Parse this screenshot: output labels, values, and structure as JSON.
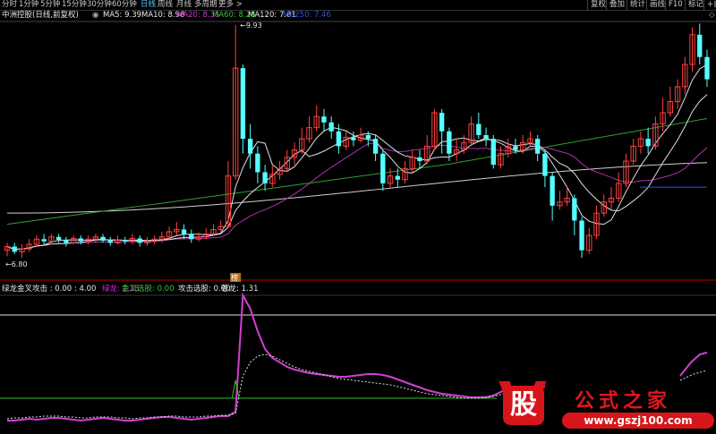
{
  "toolbar": {
    "tabs": [
      "分时",
      "1分钟",
      "5分钟",
      "15分钟",
      "30分钟",
      "60分钟",
      "日线",
      "周线",
      "月线",
      "多周期",
      "更多 >"
    ],
    "active_tab": "日线",
    "right_buttons": [
      "复权",
      "叠加",
      "统计",
      "画线",
      "F10",
      "标记",
      "+自"
    ]
  },
  "main_panel": {
    "title": "中洲控股(日线,前复权)",
    "ma_labels": [
      {
        "text": "MA5: 9.39",
        "color": "#e8e8e8"
      },
      {
        "text": "MA10: 8.98",
        "color": "#e8e8e8"
      },
      {
        "text": "MA20: 8.35",
        "color": "#d030d0"
      },
      {
        "text": "MA60: 8.28",
        "color": "#30c030"
      },
      {
        "text": "MA120: 7.81",
        "color": "#e8e8e8"
      },
      {
        "text": "MA250: 7.46",
        "color": "#3050e0"
      }
    ],
    "high_label": "9.93",
    "low_label": "6.80",
    "marker_label": "榜"
  },
  "sub_panel": {
    "labels": [
      {
        "text": "绿龙金叉攻击 : 0.00 : 4.00",
        "color": "#e8e8e8"
      },
      {
        "text": "绿龙: 2.28",
        "color": "#d030d0"
      },
      {
        "text": "金叉选股: 0.00",
        "color": "#30c030"
      },
      {
        "text": "攻击选股: 0.00",
        "color": "#e8e8e8"
      },
      {
        "text": "苍龙: 1.31",
        "color": "#e8e8e8"
      }
    ]
  },
  "watermark": {
    "glyph": "股",
    "title": "公式之家",
    "url": "www.gszj100.com"
  },
  "chart_data": {
    "type": "candlestick",
    "price_range": [
      6.8,
      9.93
    ],
    "candles": [
      [
        6.9,
        6.95,
        6.82,
        7.0
      ],
      [
        6.95,
        6.88,
        6.85,
        7.0
      ],
      [
        6.88,
        6.92,
        6.8,
        6.98
      ],
      [
        6.92,
        6.98,
        6.88,
        7.05
      ],
      [
        6.98,
        7.05,
        6.95,
        7.1
      ],
      [
        7.05,
        7.02,
        6.98,
        7.12
      ],
      [
        7.02,
        7.08,
        6.98,
        7.12
      ],
      [
        7.08,
        7.04,
        7.0,
        7.12
      ],
      [
        7.04,
        7.0,
        6.95,
        7.08
      ],
      [
        7.0,
        7.06,
        6.98,
        7.1
      ],
      [
        7.06,
        7.02,
        6.98,
        7.1
      ],
      [
        7.02,
        7.05,
        6.98,
        7.1
      ],
      [
        7.05,
        7.08,
        7.0,
        7.12
      ],
      [
        7.08,
        7.03,
        7.0,
        7.12
      ],
      [
        7.03,
        7.0,
        6.96,
        7.08
      ],
      [
        7.0,
        7.04,
        6.98,
        7.1
      ],
      [
        7.04,
        7.02,
        6.98,
        7.08
      ],
      [
        7.02,
        7.06,
        6.98,
        7.12
      ],
      [
        7.06,
        7.0,
        6.95,
        7.1
      ],
      [
        7.0,
        7.02,
        6.96,
        7.08
      ],
      [
        7.02,
        7.05,
        6.98,
        7.1
      ],
      [
        7.05,
        7.08,
        7.0,
        7.15
      ],
      [
        7.08,
        7.15,
        7.05,
        7.22
      ],
      [
        7.15,
        7.18,
        7.1,
        7.28
      ],
      [
        7.18,
        7.12,
        7.05,
        7.25
      ],
      [
        7.12,
        7.05,
        7.0,
        7.18
      ],
      [
        7.05,
        7.08,
        7.02,
        7.14
      ],
      [
        7.08,
        7.12,
        7.05,
        7.2
      ],
      [
        7.12,
        7.18,
        7.1,
        7.25
      ],
      [
        7.18,
        7.22,
        7.15,
        7.3
      ],
      [
        7.22,
        7.9,
        7.2,
        8.1
      ],
      [
        7.9,
        9.35,
        7.85,
        9.93
      ],
      [
        9.35,
        8.4,
        8.2,
        9.4
      ],
      [
        8.4,
        8.2,
        8.0,
        8.6
      ],
      [
        8.2,
        7.95,
        7.8,
        8.3
      ],
      [
        7.95,
        7.8,
        7.7,
        8.05
      ],
      [
        7.8,
        7.92,
        7.75,
        8.05
      ],
      [
        7.92,
        8.0,
        7.85,
        8.1
      ],
      [
        8.0,
        8.15,
        7.95,
        8.25
      ],
      [
        8.15,
        8.25,
        8.05,
        8.35
      ],
      [
        8.25,
        8.4,
        8.2,
        8.55
      ],
      [
        8.4,
        8.55,
        8.35,
        8.7
      ],
      [
        8.55,
        8.7,
        8.5,
        8.85
      ],
      [
        8.7,
        8.62,
        8.5,
        8.8
      ],
      [
        8.62,
        8.5,
        8.4,
        8.7
      ],
      [
        8.5,
        8.3,
        8.2,
        8.6
      ],
      [
        8.3,
        8.42,
        8.25,
        8.5
      ],
      [
        8.42,
        8.38,
        8.3,
        8.5
      ],
      [
        8.38,
        8.45,
        8.35,
        8.55
      ],
      [
        8.45,
        8.4,
        8.3,
        8.5
      ],
      [
        8.4,
        8.2,
        8.1,
        8.45
      ],
      [
        8.2,
        7.8,
        7.7,
        8.25
      ],
      [
        7.8,
        7.9,
        7.75,
        8.0
      ],
      [
        7.9,
        7.85,
        7.75,
        8.0
      ],
      [
        7.85,
        8.0,
        7.8,
        8.1
      ],
      [
        8.0,
        8.15,
        7.95,
        8.25
      ],
      [
        8.15,
        8.1,
        8.0,
        8.25
      ],
      [
        8.1,
        8.3,
        8.05,
        8.45
      ],
      [
        8.3,
        8.75,
        8.25,
        8.8
      ],
      [
        8.75,
        8.5,
        8.2,
        8.8
      ],
      [
        8.5,
        8.2,
        8.1,
        8.55
      ],
      [
        8.2,
        8.25,
        8.1,
        8.4
      ],
      [
        8.25,
        8.35,
        8.2,
        8.45
      ],
      [
        8.35,
        8.6,
        8.3,
        8.7
      ],
      [
        8.6,
        8.45,
        8.4,
        8.75
      ],
      [
        8.45,
        8.4,
        8.3,
        8.55
      ],
      [
        8.4,
        8.05,
        8.0,
        8.45
      ],
      [
        8.05,
        8.2,
        8.0,
        8.3
      ],
      [
        8.2,
        8.3,
        8.15,
        8.4
      ],
      [
        8.3,
        8.25,
        8.2,
        8.4
      ],
      [
        8.25,
        8.35,
        8.2,
        8.45
      ],
      [
        8.35,
        8.4,
        8.3,
        8.5
      ],
      [
        8.4,
        8.2,
        8.1,
        8.45
      ],
      [
        8.2,
        7.9,
        7.75,
        8.25
      ],
      [
        7.9,
        7.5,
        7.3,
        7.95
      ],
      [
        7.5,
        7.55,
        7.45,
        7.7
      ],
      [
        7.55,
        7.6,
        7.5,
        7.75
      ],
      [
        7.6,
        7.3,
        7.1,
        7.65
      ],
      [
        7.3,
        6.9,
        6.8,
        7.35
      ],
      [
        6.9,
        7.1,
        6.85,
        7.2
      ],
      [
        7.1,
        7.4,
        7.05,
        7.5
      ],
      [
        7.4,
        7.55,
        7.35,
        7.65
      ],
      [
        7.55,
        7.6,
        7.45,
        7.75
      ],
      [
        7.6,
        7.8,
        7.55,
        7.95
      ],
      [
        7.8,
        8.1,
        7.75,
        8.2
      ],
      [
        8.1,
        8.3,
        8.05,
        8.4
      ],
      [
        8.3,
        8.4,
        8.2,
        8.5
      ],
      [
        8.4,
        8.3,
        8.2,
        8.55
      ],
      [
        8.3,
        8.6,
        8.25,
        8.7
      ],
      [
        8.6,
        8.75,
        8.5,
        8.95
      ],
      [
        8.75,
        8.9,
        8.7,
        9.1
      ],
      [
        8.9,
        9.1,
        8.8,
        9.2
      ],
      [
        9.1,
        9.4,
        9.0,
        9.5
      ],
      [
        9.4,
        9.8,
        9.3,
        9.9
      ],
      [
        9.8,
        9.5,
        9.4,
        9.95
      ],
      [
        9.5,
        9.2,
        9.1,
        9.6
      ]
    ]
  }
}
